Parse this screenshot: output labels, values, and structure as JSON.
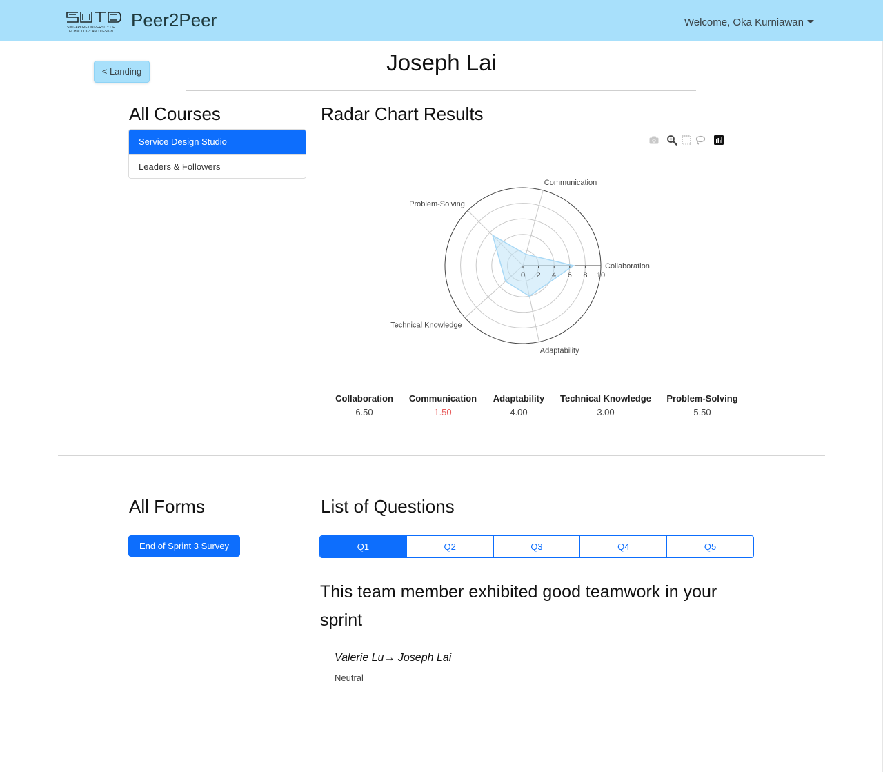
{
  "navbar": {
    "logo_text": "SUTD SINGAPORE UNIVERSITY OF TECHNOLOGY AND DESIGN",
    "brand": "Peer2Peer",
    "welcome": "Welcome, Oka Kurniawan"
  },
  "header": {
    "back_label": "< Landing",
    "title": "Joseph Lai"
  },
  "courses": {
    "heading": "All Courses",
    "items": [
      "Service Design Studio",
      "Leaders & Followers"
    ],
    "active_index": 0
  },
  "radar": {
    "heading": "Radar Chart Results",
    "toolbar_icons": [
      "camera-icon",
      "zoom-icon",
      "box-select-icon",
      "lasso-icon",
      "plotly-logo-icon"
    ]
  },
  "chart_data": {
    "type": "radar",
    "categories": [
      "Collaboration",
      "Communication",
      "Problem-Solving",
      "Technical Knowledge",
      "Adaptability"
    ],
    "values": [
      6.5,
      1.5,
      5.5,
      3.0,
      4.0
    ],
    "angles_deg": [
      0,
      75,
      135,
      222,
      282
    ],
    "radial_ticks": [
      "0",
      "2",
      "4",
      "6",
      "8",
      "10"
    ],
    "radial_range": [
      0,
      10
    ],
    "fill_color": "#bfe3f7",
    "line_color": "#a8d8f5"
  },
  "scores": [
    {
      "label": "Collaboration",
      "value": "6.50"
    },
    {
      "label": "Communication",
      "value": "1.50",
      "low": true
    },
    {
      "label": "Adaptability",
      "value": "4.00"
    },
    {
      "label": "Technical Knowledge",
      "value": "3.00"
    },
    {
      "label": "Problem-Solving",
      "value": "5.50"
    }
  ],
  "forms": {
    "heading": "All Forms",
    "items": [
      "End of Sprint 3 Survey"
    ]
  },
  "questions": {
    "heading": "List of Questions",
    "tabs": [
      "Q1",
      "Q2",
      "Q3",
      "Q4",
      "Q5"
    ],
    "active_index": 0,
    "text": "This team member exhibited good teamwork in your sprint",
    "response_from": "Valerie Lu",
    "response_to": "Joseph Lai",
    "response_name": "Valerie Lu→ Joseph Lai",
    "response_value": "Neutral"
  },
  "colors": {
    "navbar": "#a8e0fb",
    "primary": "#0d6efd",
    "low_score": "#e85d5d"
  }
}
